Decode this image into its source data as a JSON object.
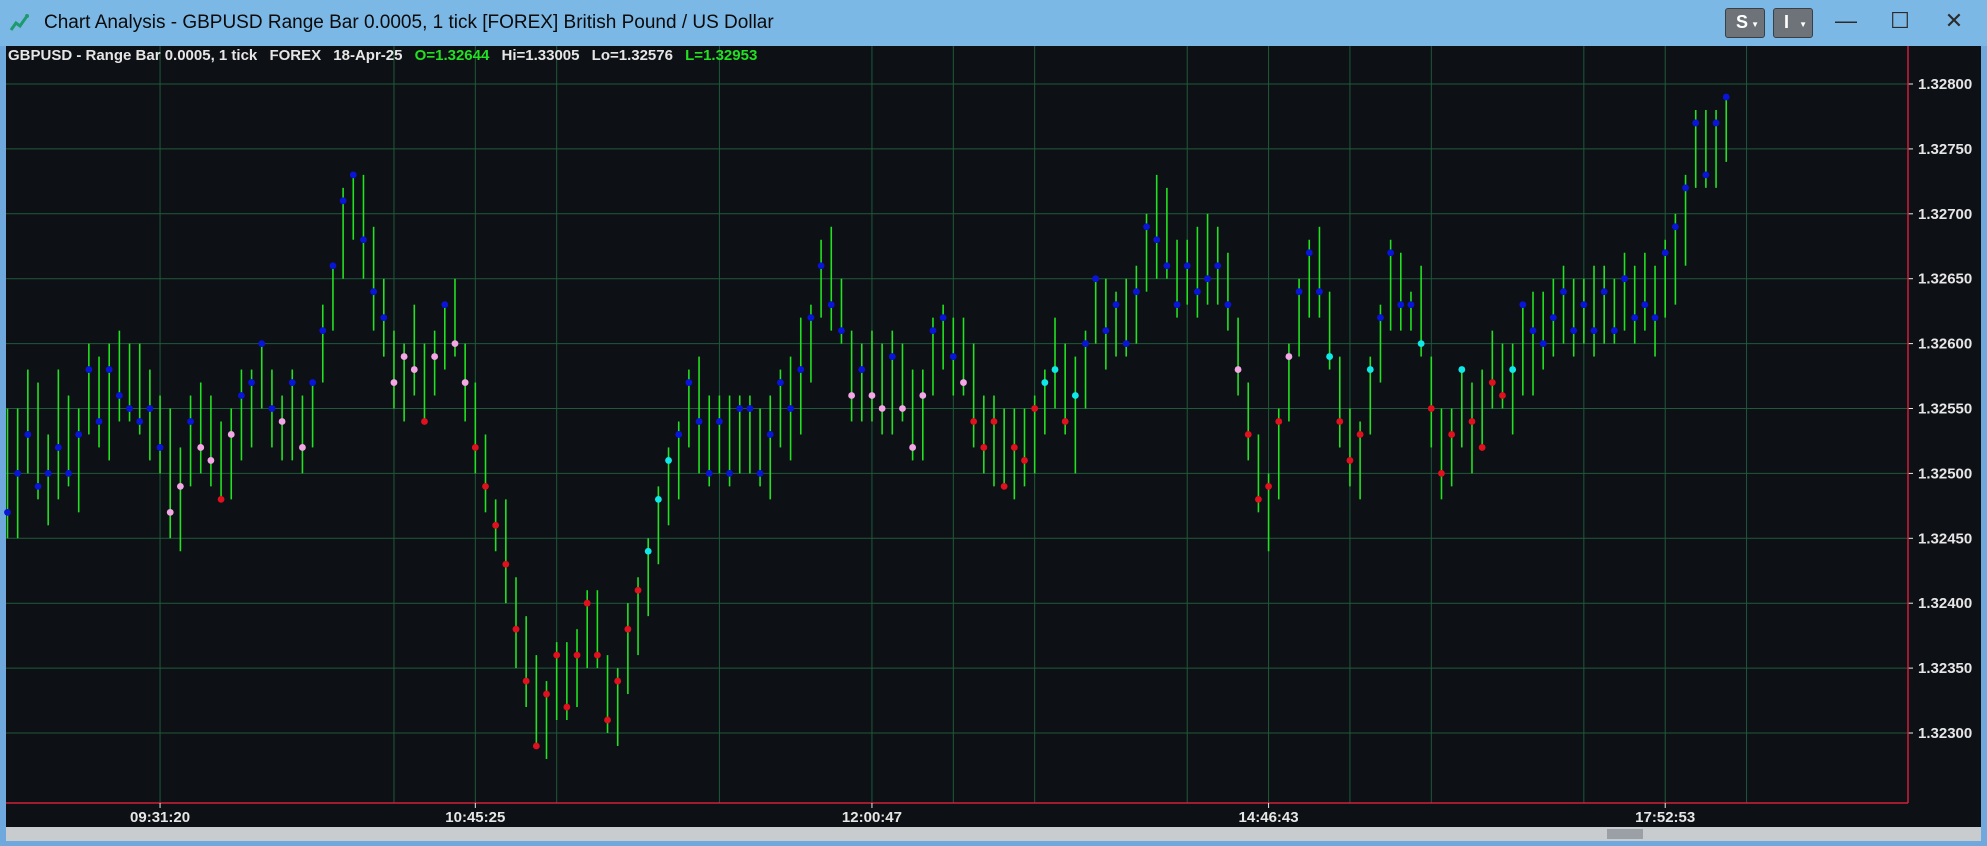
{
  "window": {
    "title": "Chart Analysis - GBPUSD Range Bar 0.0005, 1 tick [FOREX] British Pound / US Dollar",
    "s_button": "S",
    "i_button": "I",
    "minimize_glyph": "—",
    "maximize_glyph": "☐",
    "close_glyph": "✕"
  },
  "info": {
    "symbol": "GBPUSD - Range Bar 0.0005, 1 tick",
    "exchange": "FOREX",
    "date": "18-Apr-25",
    "open": "O=1.32644",
    "high": "Hi=1.33005",
    "low": "Lo=1.32576",
    "last": "L=1.32953"
  },
  "colors": {
    "background": "#0d1014",
    "grid": "#1f5a3a",
    "bar": "#22e022",
    "axis_line": "#d0203a",
    "dot_blue": "#0a14d8",
    "dot_red": "#e0101e",
    "dot_pink": "#f4a6e6",
    "dot_cyan": "#10e8e8"
  },
  "chart_data": {
    "type": "range-bar",
    "symbol": "GBPUSD",
    "ylim": [
      1.3225,
      1.3282
    ],
    "yticks": [
      "1.32300",
      "1.32350",
      "1.32400",
      "1.32450",
      "1.32500",
      "1.32550",
      "1.32600",
      "1.32650",
      "1.32700",
      "1.32750",
      "1.32800"
    ],
    "xtick_labels": [
      "09:31:20",
      "10:45:25",
      "12:00:47",
      "14:46:43",
      "17:52:53"
    ],
    "xtick_bar_index": [
      15,
      46,
      85,
      124,
      163
    ],
    "grid_bar_index": [
      15,
      38,
      46,
      54,
      70,
      85,
      93,
      101,
      116,
      124,
      132,
      140,
      155,
      163,
      171
    ],
    "grid": true,
    "bars": [
      {
        "lo": 1.3245,
        "hi": 1.3255,
        "dot": 1.3247,
        "c": "blue"
      },
      {
        "lo": 1.3245,
        "hi": 1.3255,
        "dot": 1.325,
        "c": "blue"
      },
      {
        "lo": 1.325,
        "hi": 1.3258,
        "dot": 1.3253,
        "c": "blue"
      },
      {
        "lo": 1.3248,
        "hi": 1.3257,
        "dot": 1.3249,
        "c": "blue"
      },
      {
        "lo": 1.3246,
        "hi": 1.3253,
        "dot": 1.325,
        "c": "blue"
      },
      {
        "lo": 1.3248,
        "hi": 1.3258,
        "dot": 1.3252,
        "c": "blue"
      },
      {
        "lo": 1.3249,
        "hi": 1.3256,
        "dot": 1.325,
        "c": "blue"
      },
      {
        "lo": 1.3247,
        "hi": 1.3255,
        "dot": 1.3253,
        "c": "blue"
      },
      {
        "lo": 1.3253,
        "hi": 1.326,
        "dot": 1.3258,
        "c": "blue"
      },
      {
        "lo": 1.3252,
        "hi": 1.3259,
        "dot": 1.3254,
        "c": "blue"
      },
      {
        "lo": 1.3251,
        "hi": 1.326,
        "dot": 1.3258,
        "c": "blue"
      },
      {
        "lo": 1.3254,
        "hi": 1.3261,
        "dot": 1.3256,
        "c": "blue"
      },
      {
        "lo": 1.3254,
        "hi": 1.326,
        "dot": 1.3255,
        "c": "blue"
      },
      {
        "lo": 1.3253,
        "hi": 1.326,
        "dot": 1.3254,
        "c": "blue"
      },
      {
        "lo": 1.3251,
        "hi": 1.3258,
        "dot": 1.3255,
        "c": "blue"
      },
      {
        "lo": 1.325,
        "hi": 1.3256,
        "dot": 1.3252,
        "c": "blue"
      },
      {
        "lo": 1.3245,
        "hi": 1.3255,
        "dot": 1.3247,
        "c": "pink"
      },
      {
        "lo": 1.3244,
        "hi": 1.3252,
        "dot": 1.3249,
        "c": "pink"
      },
      {
        "lo": 1.3249,
        "hi": 1.3256,
        "dot": 1.3254,
        "c": "blue"
      },
      {
        "lo": 1.325,
        "hi": 1.3257,
        "dot": 1.3252,
        "c": "pink"
      },
      {
        "lo": 1.3249,
        "hi": 1.3256,
        "dot": 1.3251,
        "c": "pink"
      },
      {
        "lo": 1.3248,
        "hi": 1.3254,
        "dot": 1.3248,
        "c": "red"
      },
      {
        "lo": 1.3248,
        "hi": 1.3255,
        "dot": 1.3253,
        "c": "pink"
      },
      {
        "lo": 1.3251,
        "hi": 1.3258,
        "dot": 1.3256,
        "c": "blue"
      },
      {
        "lo": 1.3252,
        "hi": 1.3258,
        "dot": 1.3257,
        "c": "blue"
      },
      {
        "lo": 1.3255,
        "hi": 1.326,
        "dot": 1.326,
        "c": "blue"
      },
      {
        "lo": 1.3252,
        "hi": 1.3258,
        "dot": 1.3255,
        "c": "blue"
      },
      {
        "lo": 1.3251,
        "hi": 1.3256,
        "dot": 1.3254,
        "c": "pink"
      },
      {
        "lo": 1.3251,
        "hi": 1.3258,
        "dot": 1.3257,
        "c": "blue"
      },
      {
        "lo": 1.325,
        "hi": 1.3256,
        "dot": 1.3252,
        "c": "pink"
      },
      {
        "lo": 1.3252,
        "hi": 1.3257,
        "dot": 1.3257,
        "c": "blue"
      },
      {
        "lo": 1.3257,
        "hi": 1.3263,
        "dot": 1.3261,
        "c": "blue"
      },
      {
        "lo": 1.3261,
        "hi": 1.3266,
        "dot": 1.3266,
        "c": "blue"
      },
      {
        "lo": 1.3265,
        "hi": 1.3272,
        "dot": 1.3271,
        "c": "blue"
      },
      {
        "lo": 1.3268,
        "hi": 1.3273,
        "dot": 1.3273,
        "c": "blue"
      },
      {
        "lo": 1.3265,
        "hi": 1.3273,
        "dot": 1.3268,
        "c": "blue"
      },
      {
        "lo": 1.3261,
        "hi": 1.3269,
        "dot": 1.3264,
        "c": "blue"
      },
      {
        "lo": 1.3259,
        "hi": 1.3265,
        "dot": 1.3262,
        "c": "blue"
      },
      {
        "lo": 1.3255,
        "hi": 1.3261,
        "dot": 1.3257,
        "c": "pink"
      },
      {
        "lo": 1.3254,
        "hi": 1.326,
        "dot": 1.3259,
        "c": "pink"
      },
      {
        "lo": 1.3256,
        "hi": 1.3263,
        "dot": 1.3258,
        "c": "pink"
      },
      {
        "lo": 1.3254,
        "hi": 1.326,
        "dot": 1.3254,
        "c": "red"
      },
      {
        "lo": 1.3256,
        "hi": 1.3261,
        "dot": 1.3259,
        "c": "pink"
      },
      {
        "lo": 1.3258,
        "hi": 1.3263,
        "dot": 1.3263,
        "c": "blue"
      },
      {
        "lo": 1.3259,
        "hi": 1.3265,
        "dot": 1.326,
        "c": "pink"
      },
      {
        "lo": 1.3254,
        "hi": 1.326,
        "dot": 1.3257,
        "c": "pink"
      },
      {
        "lo": 1.325,
        "hi": 1.3257,
        "dot": 1.3252,
        "c": "red"
      },
      {
        "lo": 1.3247,
        "hi": 1.3253,
        "dot": 1.3249,
        "c": "red"
      },
      {
        "lo": 1.3244,
        "hi": 1.3248,
        "dot": 1.3246,
        "c": "red"
      },
      {
        "lo": 1.324,
        "hi": 1.3248,
        "dot": 1.3243,
        "c": "red"
      },
      {
        "lo": 1.3235,
        "hi": 1.3242,
        "dot": 1.3238,
        "c": "red"
      },
      {
        "lo": 1.3232,
        "hi": 1.3239,
        "dot": 1.3234,
        "c": "red"
      },
      {
        "lo": 1.3229,
        "hi": 1.3236,
        "dot": 1.3229,
        "c": "red"
      },
      {
        "lo": 1.3228,
        "hi": 1.3234,
        "dot": 1.3233,
        "c": "red"
      },
      {
        "lo": 1.3231,
        "hi": 1.3237,
        "dot": 1.3236,
        "c": "red"
      },
      {
        "lo": 1.3231,
        "hi": 1.3237,
        "dot": 1.3232,
        "c": "red"
      },
      {
        "lo": 1.3232,
        "hi": 1.3238,
        "dot": 1.3236,
        "c": "red"
      },
      {
        "lo": 1.3235,
        "hi": 1.3241,
        "dot": 1.324,
        "c": "red"
      },
      {
        "lo": 1.3235,
        "hi": 1.3241,
        "dot": 1.3236,
        "c": "red"
      },
      {
        "lo": 1.323,
        "hi": 1.3236,
        "dot": 1.3231,
        "c": "red"
      },
      {
        "lo": 1.3229,
        "hi": 1.3235,
        "dot": 1.3234,
        "c": "red"
      },
      {
        "lo": 1.3233,
        "hi": 1.324,
        "dot": 1.3238,
        "c": "red"
      },
      {
        "lo": 1.3236,
        "hi": 1.3242,
        "dot": 1.3241,
        "c": "red"
      },
      {
        "lo": 1.3239,
        "hi": 1.3245,
        "dot": 1.3244,
        "c": "cyan"
      },
      {
        "lo": 1.3243,
        "hi": 1.3249,
        "dot": 1.3248,
        "c": "cyan"
      },
      {
        "lo": 1.3246,
        "hi": 1.3252,
        "dot": 1.3251,
        "c": "cyan"
      },
      {
        "lo": 1.3248,
        "hi": 1.3254,
        "dot": 1.3253,
        "c": "blue"
      },
      {
        "lo": 1.3252,
        "hi": 1.3258,
        "dot": 1.3257,
        "c": "blue"
      },
      {
        "lo": 1.325,
        "hi": 1.3259,
        "dot": 1.3254,
        "c": "blue"
      },
      {
        "lo": 1.3249,
        "hi": 1.3256,
        "dot": 1.325,
        "c": "blue"
      },
      {
        "lo": 1.325,
        "hi": 1.3256,
        "dot": 1.3254,
        "c": "blue"
      },
      {
        "lo": 1.3249,
        "hi": 1.3256,
        "dot": 1.325,
        "c": "blue"
      },
      {
        "lo": 1.325,
        "hi": 1.3256,
        "dot": 1.3255,
        "c": "blue"
      },
      {
        "lo": 1.325,
        "hi": 1.3256,
        "dot": 1.3255,
        "c": "blue"
      },
      {
        "lo": 1.3249,
        "hi": 1.3255,
        "dot": 1.325,
        "c": "blue"
      },
      {
        "lo": 1.3248,
        "hi": 1.3256,
        "dot": 1.3253,
        "c": "blue"
      },
      {
        "lo": 1.3252,
        "hi": 1.3258,
        "dot": 1.3257,
        "c": "blue"
      },
      {
        "lo": 1.3251,
        "hi": 1.3259,
        "dot": 1.3255,
        "c": "blue"
      },
      {
        "lo": 1.3253,
        "hi": 1.3262,
        "dot": 1.3258,
        "c": "blue"
      },
      {
        "lo": 1.3257,
        "hi": 1.3263,
        "dot": 1.3262,
        "c": "blue"
      },
      {
        "lo": 1.3262,
        "hi": 1.3268,
        "dot": 1.3266,
        "c": "blue"
      },
      {
        "lo": 1.3261,
        "hi": 1.3269,
        "dot": 1.3263,
        "c": "blue"
      },
      {
        "lo": 1.326,
        "hi": 1.3265,
        "dot": 1.3261,
        "c": "blue"
      },
      {
        "lo": 1.3254,
        "hi": 1.3261,
        "dot": 1.3256,
        "c": "pink"
      },
      {
        "lo": 1.3254,
        "hi": 1.326,
        "dot": 1.3258,
        "c": "blue"
      },
      {
        "lo": 1.3254,
        "hi": 1.3261,
        "dot": 1.3256,
        "c": "pink"
      },
      {
        "lo": 1.3253,
        "hi": 1.326,
        "dot": 1.3255,
        "c": "pink"
      },
      {
        "lo": 1.3253,
        "hi": 1.3261,
        "dot": 1.3259,
        "c": "blue"
      },
      {
        "lo": 1.3254,
        "hi": 1.326,
        "dot": 1.3255,
        "c": "pink"
      },
      {
        "lo": 1.3251,
        "hi": 1.3258,
        "dot": 1.3252,
        "c": "pink"
      },
      {
        "lo": 1.3251,
        "hi": 1.3258,
        "dot": 1.3256,
        "c": "pink"
      },
      {
        "lo": 1.3256,
        "hi": 1.3262,
        "dot": 1.3261,
        "c": "blue"
      },
      {
        "lo": 1.3258,
        "hi": 1.3263,
        "dot": 1.3262,
        "c": "blue"
      },
      {
        "lo": 1.3256,
        "hi": 1.3262,
        "dot": 1.3259,
        "c": "blue"
      },
      {
        "lo": 1.3256,
        "hi": 1.3262,
        "dot": 1.3257,
        "c": "pink"
      },
      {
        "lo": 1.3252,
        "hi": 1.326,
        "dot": 1.3254,
        "c": "red"
      },
      {
        "lo": 1.325,
        "hi": 1.3256,
        "dot": 1.3252,
        "c": "red"
      },
      {
        "lo": 1.3249,
        "hi": 1.3256,
        "dot": 1.3254,
        "c": "red"
      },
      {
        "lo": 1.3249,
        "hi": 1.3255,
        "dot": 1.3249,
        "c": "red"
      },
      {
        "lo": 1.3248,
        "hi": 1.3255,
        "dot": 1.3252,
        "c": "red"
      },
      {
        "lo": 1.3249,
        "hi": 1.3255,
        "dot": 1.3251,
        "c": "red"
      },
      {
        "lo": 1.325,
        "hi": 1.3256,
        "dot": 1.3255,
        "c": "red"
      },
      {
        "lo": 1.3253,
        "hi": 1.3258,
        "dot": 1.3257,
        "c": "cyan"
      },
      {
        "lo": 1.3255,
        "hi": 1.3262,
        "dot": 1.3258,
        "c": "cyan"
      },
      {
        "lo": 1.3253,
        "hi": 1.326,
        "dot": 1.3254,
        "c": "red"
      },
      {
        "lo": 1.325,
        "hi": 1.3259,
        "dot": 1.3256,
        "c": "cyan"
      },
      {
        "lo": 1.3255,
        "hi": 1.3261,
        "dot": 1.326,
        "c": "blue"
      },
      {
        "lo": 1.326,
        "hi": 1.3265,
        "dot": 1.3265,
        "c": "blue"
      },
      {
        "lo": 1.3258,
        "hi": 1.3265,
        "dot": 1.3261,
        "c": "blue"
      },
      {
        "lo": 1.3259,
        "hi": 1.3264,
        "dot": 1.3263,
        "c": "blue"
      },
      {
        "lo": 1.3259,
        "hi": 1.3265,
        "dot": 1.326,
        "c": "blue"
      },
      {
        "lo": 1.326,
        "hi": 1.3266,
        "dot": 1.3264,
        "c": "blue"
      },
      {
        "lo": 1.3264,
        "hi": 1.327,
        "dot": 1.3269,
        "c": "blue"
      },
      {
        "lo": 1.3265,
        "hi": 1.3273,
        "dot": 1.3268,
        "c": "blue"
      },
      {
        "lo": 1.3265,
        "hi": 1.3272,
        "dot": 1.3266,
        "c": "blue"
      },
      {
        "lo": 1.3262,
        "hi": 1.3268,
        "dot": 1.3263,
        "c": "blue"
      },
      {
        "lo": 1.3263,
        "hi": 1.3268,
        "dot": 1.3266,
        "c": "blue"
      },
      {
        "lo": 1.3262,
        "hi": 1.3269,
        "dot": 1.3264,
        "c": "blue"
      },
      {
        "lo": 1.3263,
        "hi": 1.327,
        "dot": 1.3265,
        "c": "blue"
      },
      {
        "lo": 1.3263,
        "hi": 1.3269,
        "dot": 1.3266,
        "c": "blue"
      },
      {
        "lo": 1.3261,
        "hi": 1.3267,
        "dot": 1.3263,
        "c": "blue"
      },
      {
        "lo": 1.3256,
        "hi": 1.3262,
        "dot": 1.3258,
        "c": "pink"
      },
      {
        "lo": 1.3251,
        "hi": 1.3257,
        "dot": 1.3253,
        "c": "red"
      },
      {
        "lo": 1.3247,
        "hi": 1.3253,
        "dot": 1.3248,
        "c": "red"
      },
      {
        "lo": 1.3244,
        "hi": 1.325,
        "dot": 1.3249,
        "c": "red"
      },
      {
        "lo": 1.3248,
        "hi": 1.3255,
        "dot": 1.3254,
        "c": "red"
      },
      {
        "lo": 1.3254,
        "hi": 1.326,
        "dot": 1.3259,
        "c": "pink"
      },
      {
        "lo": 1.3259,
        "hi": 1.3265,
        "dot": 1.3264,
        "c": "blue"
      },
      {
        "lo": 1.3262,
        "hi": 1.3268,
        "dot": 1.3267,
        "c": "blue"
      },
      {
        "lo": 1.3262,
        "hi": 1.3269,
        "dot": 1.3264,
        "c": "blue"
      },
      {
        "lo": 1.3258,
        "hi": 1.3264,
        "dot": 1.3259,
        "c": "cyan"
      },
      {
        "lo": 1.3252,
        "hi": 1.3259,
        "dot": 1.3254,
        "c": "red"
      },
      {
        "lo": 1.3249,
        "hi": 1.3255,
        "dot": 1.3251,
        "c": "red"
      },
      {
        "lo": 1.3248,
        "hi": 1.3254,
        "dot": 1.3253,
        "c": "red"
      },
      {
        "lo": 1.3253,
        "hi": 1.3259,
        "dot": 1.3258,
        "c": "cyan"
      },
      {
        "lo": 1.3257,
        "hi": 1.3263,
        "dot": 1.3262,
        "c": "blue"
      },
      {
        "lo": 1.3261,
        "hi": 1.3268,
        "dot": 1.3267,
        "c": "blue"
      },
      {
        "lo": 1.3261,
        "hi": 1.3267,
        "dot": 1.3263,
        "c": "blue"
      },
      {
        "lo": 1.3261,
        "hi": 1.3264,
        "dot": 1.3263,
        "c": "blue"
      },
      {
        "lo": 1.3259,
        "hi": 1.3266,
        "dot": 1.326,
        "c": "cyan"
      },
      {
        "lo": 1.3252,
        "hi": 1.3259,
        "dot": 1.3255,
        "c": "red"
      },
      {
        "lo": 1.3248,
        "hi": 1.3255,
        "dot": 1.325,
        "c": "red"
      },
      {
        "lo": 1.3249,
        "hi": 1.3255,
        "dot": 1.3253,
        "c": "red"
      },
      {
        "lo": 1.3252,
        "hi": 1.3258,
        "dot": 1.3258,
        "c": "cyan"
      },
      {
        "lo": 1.325,
        "hi": 1.3257,
        "dot": 1.3254,
        "c": "red"
      },
      {
        "lo": 1.3252,
        "hi": 1.3258,
        "dot": 1.3252,
        "c": "red"
      },
      {
        "lo": 1.3255,
        "hi": 1.3261,
        "dot": 1.3257,
        "c": "red"
      },
      {
        "lo": 1.3255,
        "hi": 1.326,
        "dot": 1.3256,
        "c": "red"
      },
      {
        "lo": 1.3253,
        "hi": 1.326,
        "dot": 1.3258,
        "c": "cyan"
      },
      {
        "lo": 1.3256,
        "hi": 1.3263,
        "dot": 1.3263,
        "c": "blue"
      },
      {
        "lo": 1.3256,
        "hi": 1.3264,
        "dot": 1.3261,
        "c": "blue"
      },
      {
        "lo": 1.3258,
        "hi": 1.3264,
        "dot": 1.326,
        "c": "blue"
      },
      {
        "lo": 1.3259,
        "hi": 1.3265,
        "dot": 1.3262,
        "c": "blue"
      },
      {
        "lo": 1.326,
        "hi": 1.3266,
        "dot": 1.3264,
        "c": "blue"
      },
      {
        "lo": 1.3259,
        "hi": 1.3265,
        "dot": 1.3261,
        "c": "blue"
      },
      {
        "lo": 1.326,
        "hi": 1.3265,
        "dot": 1.3263,
        "c": "blue"
      },
      {
        "lo": 1.3259,
        "hi": 1.3266,
        "dot": 1.3261,
        "c": "blue"
      },
      {
        "lo": 1.326,
        "hi": 1.3266,
        "dot": 1.3264,
        "c": "blue"
      },
      {
        "lo": 1.326,
        "hi": 1.3265,
        "dot": 1.3261,
        "c": "blue"
      },
      {
        "lo": 1.3261,
        "hi": 1.3267,
        "dot": 1.3265,
        "c": "blue"
      },
      {
        "lo": 1.326,
        "hi": 1.3266,
        "dot": 1.3262,
        "c": "blue"
      },
      {
        "lo": 1.3261,
        "hi": 1.3267,
        "dot": 1.3263,
        "c": "blue"
      },
      {
        "lo": 1.3259,
        "hi": 1.3266,
        "dot": 1.3262,
        "c": "blue"
      },
      {
        "lo": 1.3262,
        "hi": 1.3268,
        "dot": 1.3267,
        "c": "blue"
      },
      {
        "lo": 1.3263,
        "hi": 1.327,
        "dot": 1.3269,
        "c": "blue"
      },
      {
        "lo": 1.3266,
        "hi": 1.3273,
        "dot": 1.3272,
        "c": "blue"
      },
      {
        "lo": 1.3272,
        "hi": 1.3278,
        "dot": 1.3277,
        "c": "blue"
      },
      {
        "lo": 1.3272,
        "hi": 1.3278,
        "dot": 1.3273,
        "c": "blue"
      },
      {
        "lo": 1.3272,
        "hi": 1.3278,
        "dot": 1.3277,
        "c": "blue"
      },
      {
        "lo": 1.3274,
        "hi": 1.3279,
        "dot": 1.3279,
        "c": "blue"
      }
    ]
  }
}
